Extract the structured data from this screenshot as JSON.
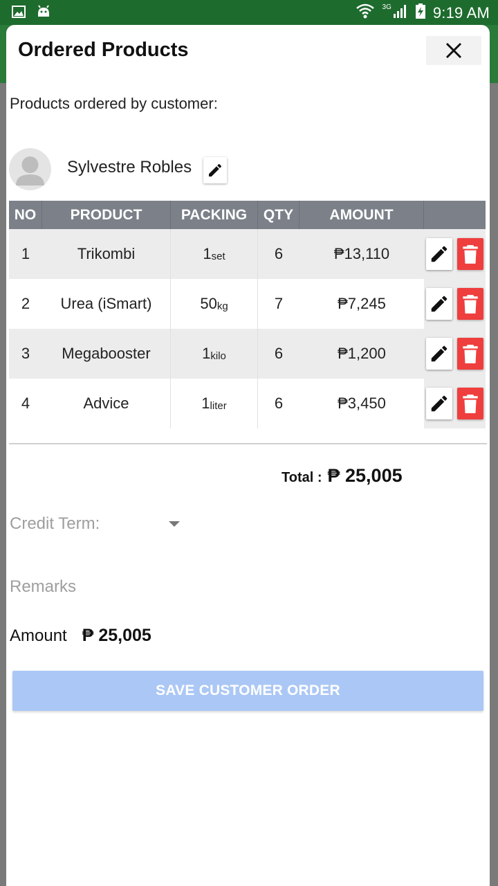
{
  "status_bar": {
    "time": "9:19 AM",
    "network": "3G",
    "icons": [
      "image-icon",
      "android-icon",
      "wifi-icon",
      "signal-icon",
      "battery-charging-icon"
    ]
  },
  "dialog": {
    "title": "Ordered Products",
    "subtitle": "Products ordered by customer:",
    "close_icon": "close-icon"
  },
  "customer": {
    "name": "Sylvestre Robles"
  },
  "table": {
    "headers": [
      "NO",
      "PRODUCT",
      "PACKING",
      "QTY",
      "AMOUNT",
      ""
    ],
    "rows": [
      {
        "no": "1",
        "product": "Trikombi",
        "pack_qty": "1",
        "pack_unit": "set",
        "qty": "6",
        "amount": "₱13,110"
      },
      {
        "no": "2",
        "product": "Urea (iSmart)",
        "pack_qty": "50",
        "pack_unit": "kg",
        "qty": "7",
        "amount": "₱7,245"
      },
      {
        "no": "3",
        "product": "Megabooster",
        "pack_qty": "1",
        "pack_unit": "kilo",
        "qty": "6",
        "amount": "₱1,200"
      },
      {
        "no": "4",
        "product": "Advice",
        "pack_qty": "1",
        "pack_unit": "liter",
        "qty": "6",
        "amount": "₱3,450"
      }
    ]
  },
  "summary": {
    "total_label": "Total :",
    "total_value": "₱ 25,005",
    "credit_term_placeholder": "Credit Term:",
    "remarks_placeholder": "Remarks",
    "amount_label": "Amount",
    "amount_value": "₱ 25,005"
  },
  "actions": {
    "save_label": "SAVE CUSTOMER ORDER"
  },
  "colors": {
    "status_bar": "#1e6b2e",
    "table_header": "#7b8089",
    "delete_button": "#ef3e3e",
    "save_button": "#abc7f5"
  }
}
